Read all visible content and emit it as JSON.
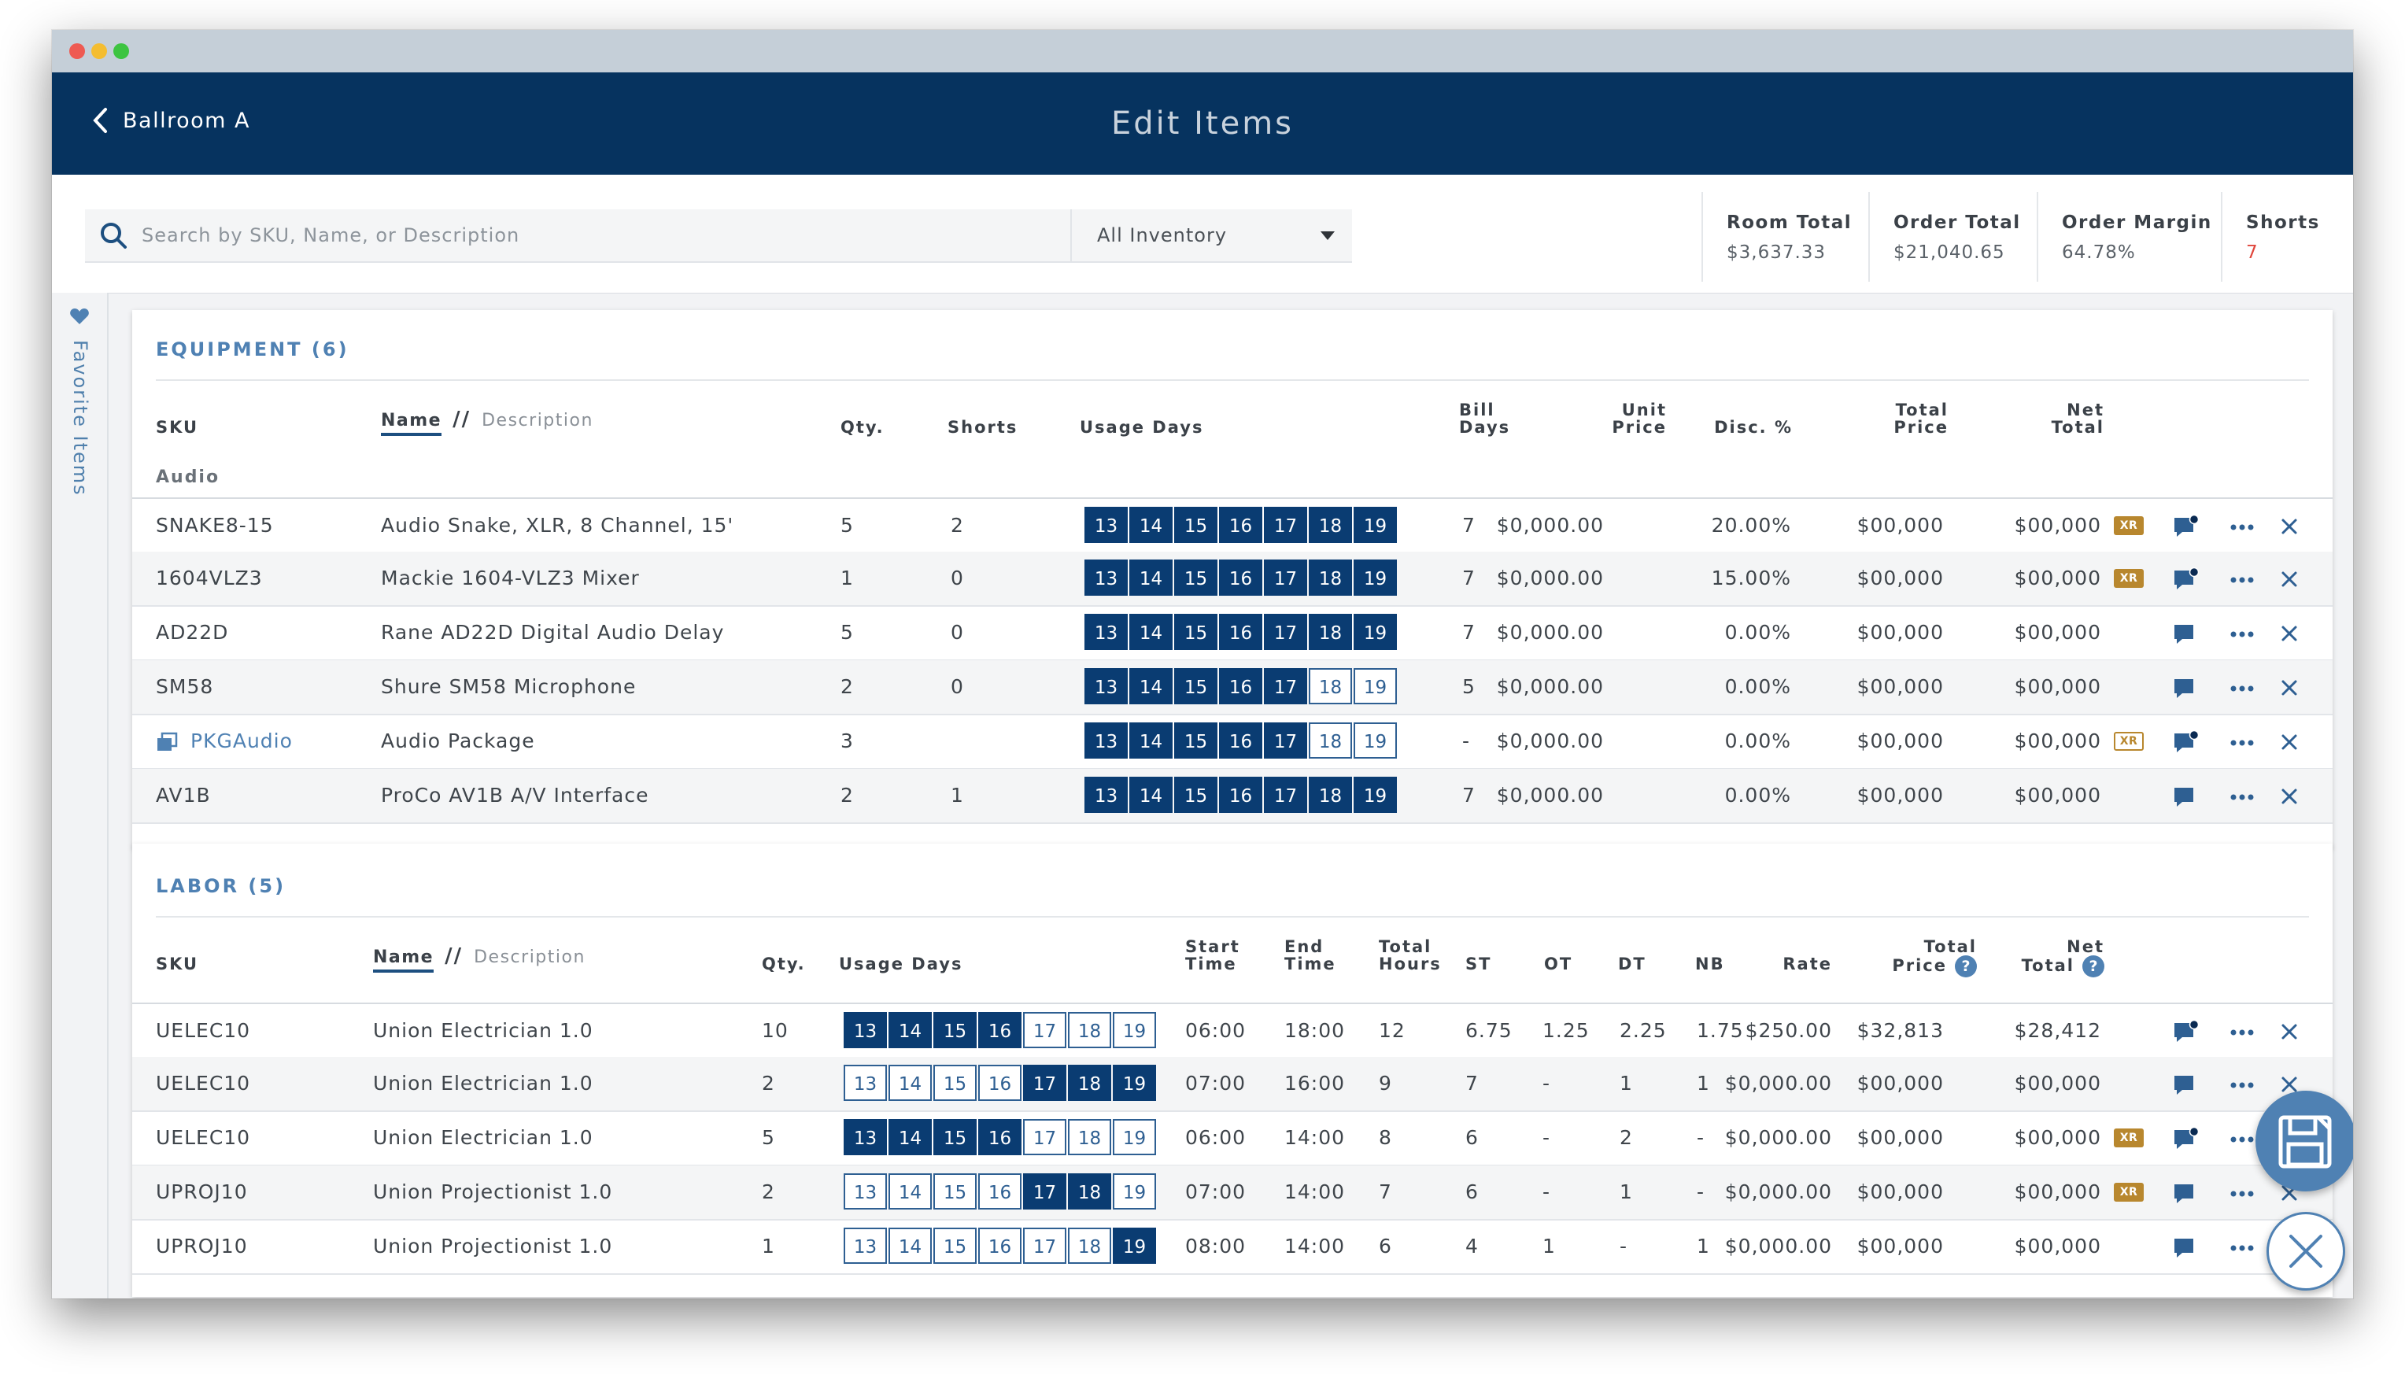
{
  "window": {
    "controls": [
      "close",
      "minimize",
      "maximize"
    ]
  },
  "header": {
    "back_label": "Ballroom A",
    "title": "Edit Items"
  },
  "search": {
    "placeholder": "Search by SKU, Name, or Description",
    "value": ""
  },
  "inventory_filter": {
    "selected": "All Inventory"
  },
  "stats": [
    {
      "label": "Room Total",
      "value": "$3,637.33"
    },
    {
      "label": "Order Total",
      "value": "$21,040.65"
    },
    {
      "label": "Order Margin",
      "value": "64.78%"
    },
    {
      "label": "Shorts",
      "value": "7"
    }
  ],
  "sidebar": {
    "label": "Favorite Items",
    "icon": "heart-icon"
  },
  "equipment": {
    "title": "EQUIPMENT (6)",
    "headers": {
      "sku": "SKU",
      "name": "Name",
      "slash": "//",
      "description": "Description",
      "qty": "Qty.",
      "shorts": "Shorts",
      "usage_days": "Usage Days",
      "bill_days_1": "Bill",
      "bill_days_2": "Days",
      "unit_price_1": "Unit",
      "unit_price_2": "Price",
      "disc": "Disc. %",
      "total_price_1": "Total",
      "total_price_2": "Price",
      "net_total_1": "Net",
      "net_total_2": "Total"
    },
    "group": "Audio",
    "rows": [
      {
        "sku": "SNAKE8-15",
        "name": "Audio Snake, XLR, 8 Channel, 15'",
        "qty": "5",
        "shorts": "2",
        "days": [
          13,
          14,
          15,
          16,
          17,
          18,
          19
        ],
        "days_on": [
          true,
          true,
          true,
          true,
          true,
          true,
          true
        ],
        "bill_days": "7",
        "unit_price": "$0,000.00",
        "disc": "20.00%",
        "total_price": "$00,000",
        "net_total": "$00,000",
        "xr": "filled",
        "xr_label": "XR",
        "comment_dot": true,
        "package": false
      },
      {
        "sku": "1604VLZ3",
        "name": "Mackie 1604-VLZ3 Mixer",
        "qty": "1",
        "shorts": "0",
        "days": [
          13,
          14,
          15,
          16,
          17,
          18,
          19
        ],
        "days_on": [
          true,
          true,
          true,
          true,
          true,
          true,
          true
        ],
        "bill_days": "7",
        "unit_price": "$0,000.00",
        "disc": "15.00%",
        "total_price": "$00,000",
        "net_total": "$00,000",
        "xr": "filled",
        "xr_label": "XR",
        "comment_dot": true,
        "package": false
      },
      {
        "sku": "AD22D",
        "name": "Rane AD22D Digital Audio Delay",
        "qty": "5",
        "shorts": "0",
        "days": [
          13,
          14,
          15,
          16,
          17,
          18,
          19
        ],
        "days_on": [
          true,
          true,
          true,
          true,
          true,
          true,
          true
        ],
        "bill_days": "7",
        "unit_price": "$0,000.00",
        "disc": "0.00%",
        "total_price": "$00,000",
        "net_total": "$00,000",
        "xr": "none",
        "xr_label": "",
        "comment_dot": false,
        "package": false
      },
      {
        "sku": "SM58",
        "name": "Shure SM58 Microphone",
        "qty": "2",
        "shorts": "0",
        "days": [
          13,
          14,
          15,
          16,
          17,
          18,
          19
        ],
        "days_on": [
          true,
          true,
          true,
          true,
          true,
          false,
          false
        ],
        "bill_days": "5",
        "unit_price": "$0,000.00",
        "disc": "0.00%",
        "total_price": "$00,000",
        "net_total": "$00,000",
        "xr": "none",
        "xr_label": "",
        "comment_dot": false,
        "package": false
      },
      {
        "sku": "PKGAudio",
        "name": "Audio Package",
        "qty": "3",
        "shorts": "",
        "days": [
          13,
          14,
          15,
          16,
          17,
          18,
          19
        ],
        "days_on": [
          true,
          true,
          true,
          true,
          true,
          false,
          false
        ],
        "bill_days": "-",
        "unit_price": "$0,000.00",
        "disc": "0.00%",
        "total_price": "$00,000",
        "net_total": "$00,000",
        "xr": "outline",
        "xr_label": "XR",
        "comment_dot": true,
        "package": true
      },
      {
        "sku": "AV1B",
        "name": "ProCo AV1B A/V Interface",
        "qty": "2",
        "shorts": "1",
        "days": [
          13,
          14,
          15,
          16,
          17,
          18,
          19
        ],
        "days_on": [
          true,
          true,
          true,
          true,
          true,
          true,
          true
        ],
        "bill_days": "7",
        "unit_price": "$0,000.00",
        "disc": "0.00%",
        "total_price": "$00,000",
        "net_total": "$00,000",
        "xr": "none",
        "xr_label": "",
        "comment_dot": false,
        "package": false
      }
    ]
  },
  "labor": {
    "title": "LABOR (5)",
    "headers": {
      "sku": "SKU",
      "name": "Name",
      "slash": "//",
      "description": "Description",
      "qty": "Qty.",
      "usage_days": "Usage Days",
      "start_1": "Start",
      "start_2": "Time",
      "end_1": "End",
      "end_2": "Time",
      "hours_1": "Total",
      "hours_2": "Hours",
      "st": "ST",
      "ot": "OT",
      "dt": "DT",
      "nb": "NB",
      "rate": "Rate",
      "total_price_1": "Total",
      "total_price_2": "Price",
      "net_total_1": "Net",
      "net_total_2": "Total",
      "help": "?"
    },
    "rows": [
      {
        "sku": "UELEC10",
        "name": "Union Electrician 1.0",
        "qty": "10",
        "days": [
          13,
          14,
          15,
          16,
          17,
          18,
          19
        ],
        "days_on": [
          true,
          true,
          true,
          true,
          false,
          false,
          false
        ],
        "start": "06:00",
        "end": "18:00",
        "hours": "12",
        "st": "6.75",
        "ot": "1.25",
        "dt": "2.25",
        "nb": "1.75",
        "rate": "$250.00",
        "total_price": "$32,813",
        "net_total": "$28,412",
        "xr": "none",
        "xr_label": "",
        "comment_dot": true
      },
      {
        "sku": "UELEC10",
        "name": "Union Electrician 1.0",
        "qty": "2",
        "days": [
          13,
          14,
          15,
          16,
          17,
          18,
          19
        ],
        "days_on": [
          false,
          false,
          false,
          false,
          true,
          true,
          true
        ],
        "start": "07:00",
        "end": "16:00",
        "hours": "9",
        "st": "7",
        "ot": "-",
        "dt": "1",
        "nb": "1",
        "rate": "$0,000.00",
        "total_price": "$00,000",
        "net_total": "$00,000",
        "xr": "none",
        "xr_label": "",
        "comment_dot": false
      },
      {
        "sku": "UELEC10",
        "name": "Union Electrician 1.0",
        "qty": "5",
        "days": [
          13,
          14,
          15,
          16,
          17,
          18,
          19
        ],
        "days_on": [
          true,
          true,
          true,
          true,
          false,
          false,
          false
        ],
        "start": "06:00",
        "end": "14:00",
        "hours": "8",
        "st": "6",
        "ot": "-",
        "dt": "2",
        "nb": "-",
        "rate": "$0,000.00",
        "total_price": "$00,000",
        "net_total": "$00,000",
        "xr": "filled",
        "xr_label": "XR",
        "comment_dot": true
      },
      {
        "sku": "UPROJ10",
        "name": "Union Projectionist 1.0",
        "qty": "2",
        "days": [
          13,
          14,
          15,
          16,
          17,
          18,
          19
        ],
        "days_on": [
          false,
          false,
          false,
          false,
          true,
          true,
          false
        ],
        "start": "07:00",
        "end": "14:00",
        "hours": "7",
        "st": "6",
        "ot": "-",
        "dt": "1",
        "nb": "-",
        "rate": "$0,000.00",
        "total_price": "$00,000",
        "net_total": "$00,000",
        "xr": "filled",
        "xr_label": "XR",
        "comment_dot": false
      },
      {
        "sku": "UPROJ10",
        "name": "Union Projectionist 1.0",
        "qty": "1",
        "days": [
          13,
          14,
          15,
          16,
          17,
          18,
          19
        ],
        "days_on": [
          false,
          false,
          false,
          false,
          false,
          false,
          true
        ],
        "start": "08:00",
        "end": "14:00",
        "hours": "6",
        "st": "4",
        "ot": "1",
        "dt": "-",
        "nb": "1",
        "rate": "$0,000.00",
        "total_price": "$00,000",
        "net_total": "$00,000",
        "xr": "none",
        "xr_label": "",
        "comment_dot": false
      }
    ]
  },
  "fabs": {
    "save_icon": "floppy-disk-icon",
    "close_icon": "close-icon"
  },
  "colors": {
    "navy": "#06335f",
    "accent": "#4f81b3",
    "xr_gold": "#b8872e",
    "shorts_red": "#e0463c"
  }
}
